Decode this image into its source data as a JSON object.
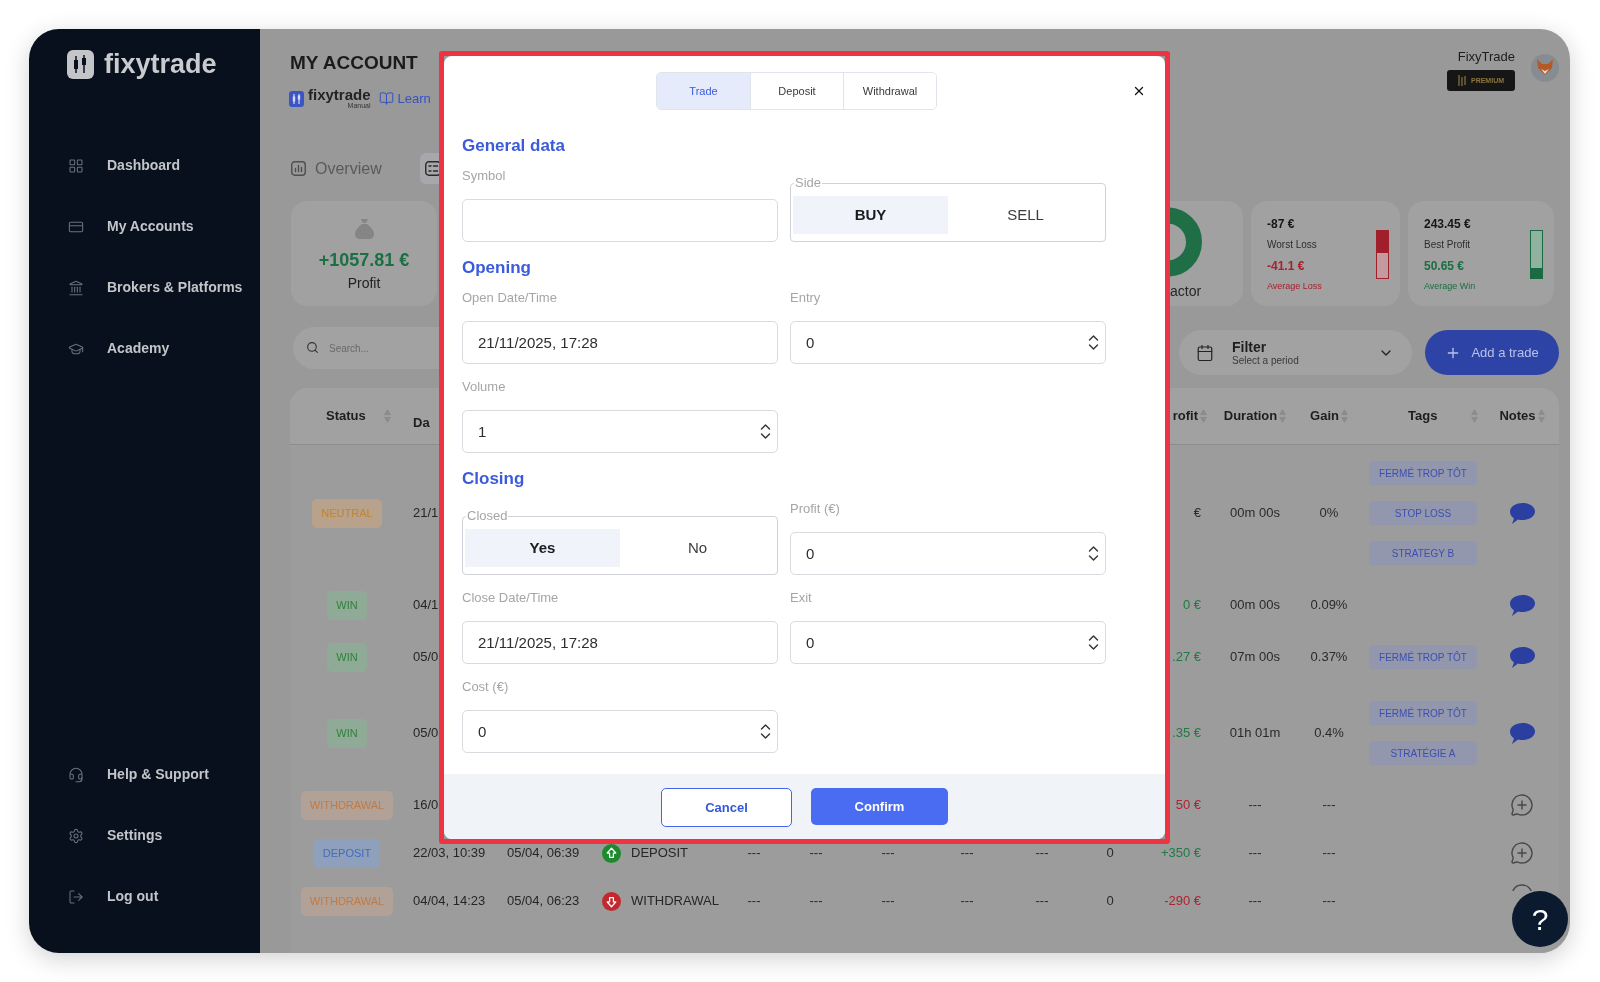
{
  "sidebar": {
    "logo": "fixytrade",
    "nav": [
      {
        "label": "Dashboard",
        "selected": false
      },
      {
        "label": "My Accounts",
        "selected": false
      },
      {
        "label": "Brokers & Platforms",
        "selected": false
      },
      {
        "label": "Academy",
        "selected": false
      }
    ],
    "bottom_nav": [
      {
        "label": "Help & Support",
        "selected": false
      },
      {
        "label": "Settings",
        "selected": false
      },
      {
        "label": "Log out",
        "selected": false
      }
    ]
  },
  "header": {
    "title": "MY ACCOUNT",
    "platform": {
      "name": "fixytrade",
      "subtitle": "Manual"
    },
    "learn_link": "Learn",
    "user": {
      "name": "FixyTrade",
      "plan": "PREMIUM"
    }
  },
  "view_tabs": [
    {
      "label": "Overview",
      "selected": false
    },
    {
      "selected": true
    }
  ],
  "profit_card": {
    "value": "+1057.81 €",
    "label": "Profit"
  },
  "factor_card": {
    "label": "actor"
  },
  "stat_cards": [
    {
      "kind": "loss",
      "value": "-87 €",
      "label": "Worst Loss",
      "average": "-41.1 €",
      "average_label": "Average Loss",
      "level": 0.47
    },
    {
      "kind": "profit",
      "value": "243.45 €",
      "label": "Best Profit",
      "average": "50.65 €",
      "average_label": "Average Win",
      "level": 0.21
    }
  ],
  "search": {
    "placeholder": "Search..."
  },
  "filter": {
    "label": "Filter",
    "subtitle": "Select a period"
  },
  "add_button": "Add a trade",
  "table": {
    "columns": [
      {
        "label": "Status"
      },
      {
        "label": "Da"
      },
      {
        "label": "rofit"
      },
      {
        "label": "Duration"
      },
      {
        "label": "Gain"
      },
      {
        "label": "Tags"
      },
      {
        "label": "Notes"
      }
    ],
    "rows": [
      {
        "status": {
          "label": "NEUTRAL",
          "kind": "neutral"
        },
        "column_2": "21/1",
        "column_11": {
          "text": "€",
          "kind": "flat"
        },
        "duration": "00m 00s",
        "gain": "0%",
        "tags": [
          "FERMÉ TROP TÔT",
          "STOP LOSS",
          "STRATEGY B"
        ],
        "has_note": true
      },
      {
        "status": {
          "label": "WIN",
          "kind": "win"
        },
        "column_2": "04/1",
        "column_11": {
          "text": "0 €",
          "kind": "gain"
        },
        "duration": "00m 00s",
        "gain": "0.09%",
        "has_note": true
      },
      {
        "status": {
          "label": "WIN",
          "kind": "win"
        },
        "column_2": "05/0",
        "column_11": {
          "text": ".27 €",
          "kind": "gain"
        },
        "duration": "07m 00s",
        "gain": "0.37%",
        "tags": [
          "FERMÉ TROP TÔT"
        ],
        "has_note": true
      },
      {
        "status": {
          "label": "WIN",
          "kind": "win"
        },
        "column_2": "05/0",
        "column_11": {
          "text": ".35 €",
          "kind": "gain"
        },
        "duration": "01h 01m",
        "gain": "0.4%",
        "tags": [
          "FERMÉ TROP TÔT",
          "STRATÉGIE A"
        ],
        "has_note": true
      },
      {
        "status": {
          "label": "WITHDRAWAL",
          "kind": "withdrawal"
        },
        "column_2": "16/0",
        "column_11": {
          "text": "50 €",
          "kind": "loss"
        },
        "duration": "---",
        "gain": "---",
        "has_note": false
      },
      {
        "status": {
          "label": "DEPOSIT",
          "kind": "deposit"
        },
        "column_2": "22/03, 10:39",
        "column_3": "05/04, 06:39",
        "column_4": {
          "text": "DEPOSIT",
          "kind": "deposit"
        },
        "column_5": "---",
        "column_6": "---",
        "column_7": "---",
        "column_8": "---",
        "column_9": "---",
        "column_10": "0",
        "column_11": {
          "text": "+350 €",
          "kind": "gain"
        },
        "duration": "---",
        "gain": "---",
        "has_note": false
      },
      {
        "status": {
          "label": "WITHDRAWAL",
          "kind": "withdrawal"
        },
        "column_2": "04/04, 14:23",
        "column_3": "05/04, 06:23",
        "column_4": {
          "text": "WITHDRAWAL",
          "kind": "withdrawal"
        },
        "column_5": "---",
        "column_6": "---",
        "column_7": "---",
        "column_8": "---",
        "column_9": "---",
        "column_10": "0",
        "column_11": {
          "text": "-290 €",
          "kind": "loss"
        },
        "duration": "---",
        "gain": "---",
        "has_note": false
      }
    ]
  },
  "help_button": "?",
  "dialog": {
    "tabs": [
      {
        "label": "Trade",
        "selected": true
      },
      {
        "label": "Deposit",
        "selected": false
      },
      {
        "label": "Withdrawal",
        "selected": false
      }
    ],
    "sections": [
      {
        "title": "General data",
        "fields": [
          {
            "kind": "text",
            "label": "Symbol"
          },
          {
            "kind": "toggle",
            "label": "Side",
            "options": [
              {
                "label": "BUY",
                "selected": true
              },
              {
                "label": "SELL",
                "selected": false
              }
            ]
          }
        ]
      },
      {
        "title": "Opening",
        "fields": [
          {
            "kind": "datetime",
            "label": "Open Date/Time",
            "value": "21/11/2025, 17:28"
          },
          {
            "kind": "number",
            "label": "Entry",
            "value": "0"
          },
          {
            "kind": "number",
            "label": "Volume",
            "value": "1"
          }
        ]
      },
      {
        "title": "Closing",
        "fields": [
          {
            "kind": "toggle",
            "label": "Closed",
            "options": [
              {
                "label": "Yes",
                "selected": true
              },
              {
                "label": "No",
                "selected": false
              }
            ]
          },
          {
            "kind": "number",
            "label": "Profit (€)",
            "value": "0"
          },
          {
            "kind": "datetime",
            "label": "Close Date/Time",
            "value": "21/11/2025, 17:28"
          },
          {
            "kind": "number",
            "label": "Exit",
            "value": "0"
          },
          {
            "kind": "number",
            "label": "Cost (€)",
            "value": "0"
          }
        ]
      }
    ],
    "buttons": [
      {
        "label": "Cancel",
        "kind": "secondary"
      },
      {
        "label": "Confirm",
        "kind": "primary"
      }
    ]
  }
}
